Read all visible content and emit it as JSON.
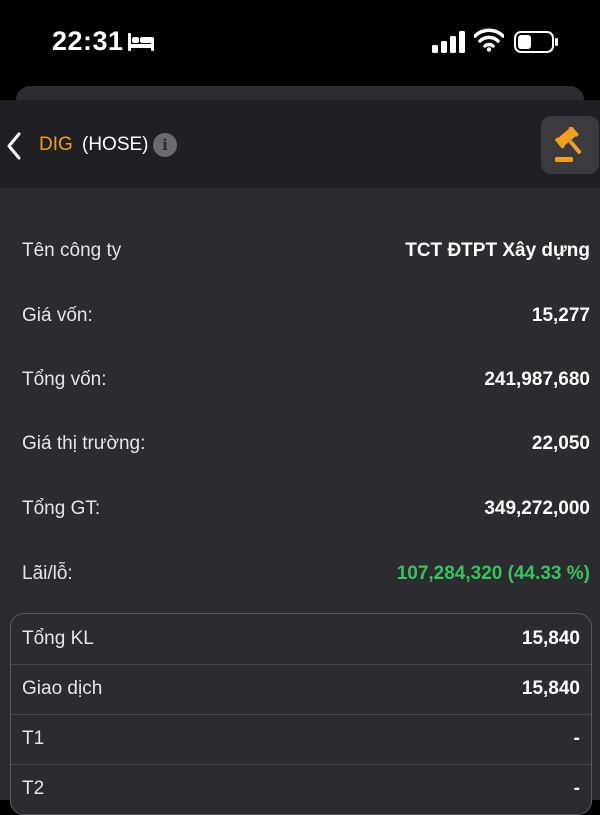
{
  "status_bar": {
    "time": "22:31"
  },
  "header": {
    "symbol": "DIG",
    "exchange": "(HOSE)",
    "info_glyph": "i",
    "symbol_color": "#f0a01a"
  },
  "details": [
    {
      "label": "Tên công ty",
      "value": "TCT ĐTPT Xây dựng"
    },
    {
      "label": "Giá vốn:",
      "value": "15,277"
    },
    {
      "label": "Tổng vốn:",
      "value": "241,987,680"
    },
    {
      "label": "Giá thị trường:",
      "value": "22,050"
    },
    {
      "label": "Tổng GT:",
      "value": "349,272,000"
    },
    {
      "label": "Lãi/lỗ:",
      "value": "107,284,320 (44.33 %)",
      "color": "#35c45a"
    }
  ],
  "volume_card": [
    {
      "label": "Tổng KL",
      "value": "15,840"
    },
    {
      "label": "Giao dịch",
      "value": "15,840"
    },
    {
      "label": "T1",
      "value": "-"
    },
    {
      "label": "T2",
      "value": "-"
    }
  ],
  "icons": [
    "bed-icon",
    "signal-icon",
    "wifi-icon",
    "battery-icon",
    "back-icon",
    "info-icon",
    "gavel-icon"
  ]
}
